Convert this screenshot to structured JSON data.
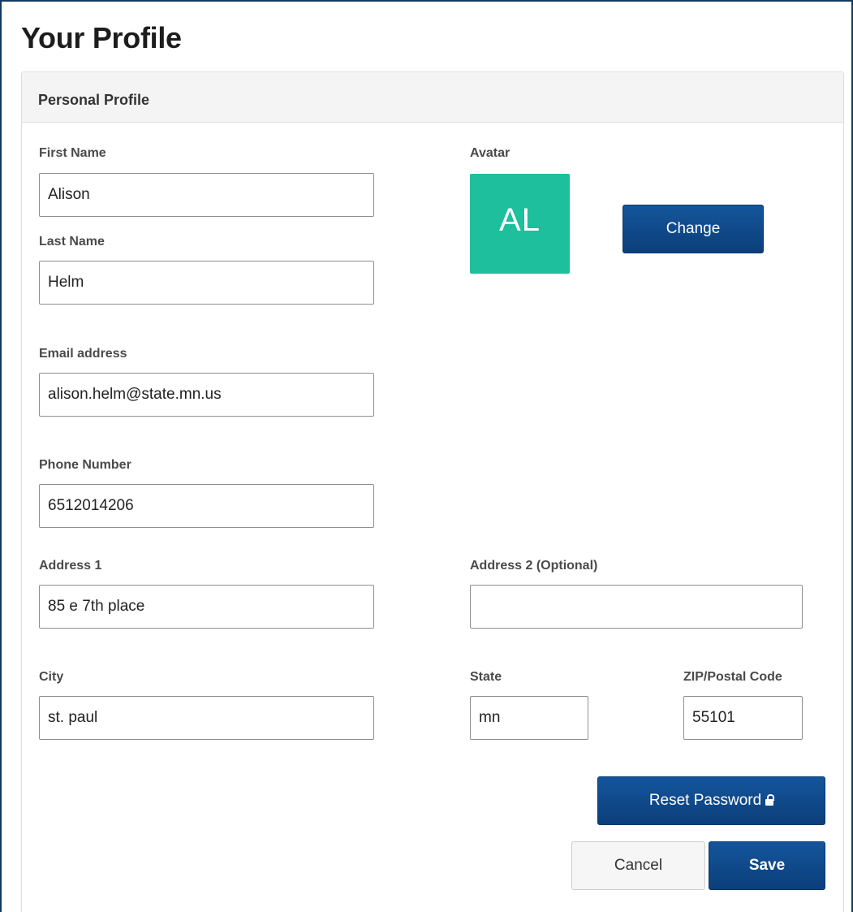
{
  "page": {
    "title": "Your Profile"
  },
  "panel": {
    "title": "Personal Profile"
  },
  "form": {
    "first_name": {
      "label": "First Name",
      "value": "Alison"
    },
    "last_name": {
      "label": "Last Name",
      "value": "Helm"
    },
    "email": {
      "label": "Email address",
      "value": "alison.helm@state.mn.us"
    },
    "phone": {
      "label": "Phone Number",
      "value": "6512014206"
    },
    "address1": {
      "label": "Address 1",
      "value": "85 e 7th place"
    },
    "address2": {
      "label": "Address 2 (Optional)",
      "value": ""
    },
    "city": {
      "label": "City",
      "value": "st. paul"
    },
    "state": {
      "label": "State",
      "value": "mn"
    },
    "zip": {
      "label": "ZIP/Postal Code",
      "value": "55101"
    }
  },
  "avatar": {
    "label": "Avatar",
    "initials": "AL",
    "color": "#1dbf9c",
    "change_label": "Change"
  },
  "actions": {
    "reset_password_label": "Reset Password",
    "reset_password_icon": "lock-icon",
    "cancel_label": "Cancel",
    "save_label": "Save"
  },
  "colors": {
    "primary": "#0d4585",
    "frame_border": "#123a63",
    "panel_header_bg": "#f4f4f4"
  }
}
